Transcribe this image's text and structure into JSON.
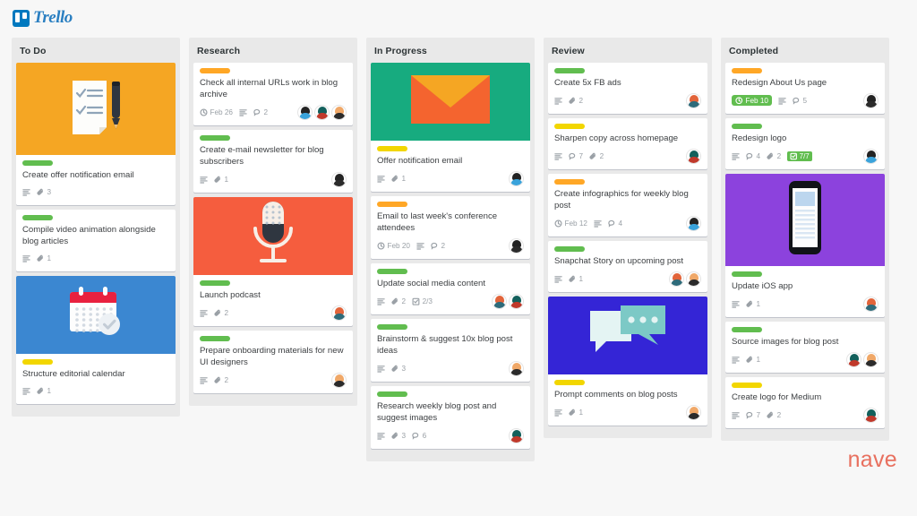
{
  "brand": {
    "name": "Trello",
    "mark": "trello-logo-icon"
  },
  "footer": {
    "vendor": "nave"
  },
  "colors": {
    "label_green": "#61bd4f",
    "label_yellow": "#f2d600",
    "label_orange": "#ffa726",
    "trello_blue": "#0079bf",
    "nave_red": "#e8705f",
    "column_bg": "#e9e9e9",
    "page_bg": "#f7f7f7"
  },
  "columns": [
    {
      "title": "To Do",
      "cards": [
        {
          "cover": "orange",
          "cover_icon": "checklist-and-pen-illustration",
          "label": "green",
          "title": "Create offer notification email",
          "meta": [
            {
              "icon": "description-icon"
            },
            {
              "icon": "attachment-icon",
              "value": "3"
            }
          ],
          "avatars": []
        },
        {
          "label": "green",
          "title": "Compile video animation alongside blog articles",
          "meta": [
            {
              "icon": "description-icon"
            },
            {
              "icon": "attachment-icon",
              "value": "1"
            }
          ],
          "avatars": []
        },
        {
          "cover": "blue",
          "cover_icon": "calendar-check-illustration",
          "label": "yellow",
          "title": "Structure editorial calendar",
          "meta": [
            {
              "icon": "description-icon"
            },
            {
              "icon": "attachment-icon",
              "value": "1"
            }
          ],
          "avatars": []
        }
      ]
    },
    {
      "title": "Research",
      "cards": [
        {
          "label": "orange",
          "title": "Check all internal URLs work in blog archive",
          "meta": [
            {
              "icon": "clock-icon",
              "value": "Feb 26"
            },
            {
              "icon": "description-icon"
            },
            {
              "icon": "comment-icon",
              "value": "2"
            }
          ],
          "avatars": [
            "dark-hair-blue-shirt",
            "teal-hair-red-shirt",
            "ginger-hair-dark-shirt"
          ]
        },
        {
          "label": "green",
          "title": "Create e-mail newsletter for blog subscribers",
          "meta": [
            {
              "icon": "description-icon"
            },
            {
              "icon": "attachment-icon",
              "value": "1"
            }
          ],
          "avatars": [
            "dark-hair-dark-shirt"
          ]
        },
        {
          "cover": "red",
          "cover_icon": "microphone-illustration",
          "label": "green",
          "title": "Launch podcast",
          "meta": [
            {
              "icon": "description-icon"
            },
            {
              "icon": "attachment-icon",
              "value": "2"
            }
          ],
          "avatars": [
            "red-hair-teal-shirt"
          ]
        },
        {
          "label": "green",
          "title": "Prepare onboarding materials for new UI designers",
          "meta": [
            {
              "icon": "description-icon"
            },
            {
              "icon": "attachment-icon",
              "value": "2"
            }
          ],
          "avatars": [
            "ginger-hair-dark-shirt"
          ]
        }
      ]
    },
    {
      "title": "In Progress",
      "cards": [
        {
          "cover": "green",
          "cover_icon": "envelope-illustration",
          "label": "yellow",
          "title": "Offer notification email",
          "meta": [
            {
              "icon": "description-icon"
            },
            {
              "icon": "attachment-icon",
              "value": "1"
            }
          ],
          "avatars": [
            "dark-hair-blue-shirt"
          ]
        },
        {
          "label": "orange",
          "title": "Email to last week's conference attendees",
          "meta": [
            {
              "icon": "clock-icon",
              "value": "Feb 20"
            },
            {
              "icon": "description-icon"
            },
            {
              "icon": "comment-icon",
              "value": "2"
            }
          ],
          "avatars": [
            "dark-hair-dark-shirt"
          ]
        },
        {
          "label": "green",
          "title": "Update social media content",
          "meta": [
            {
              "icon": "description-icon"
            },
            {
              "icon": "attachment-icon",
              "value": "2"
            },
            {
              "icon": "checklist-icon",
              "value": "2/3"
            }
          ],
          "avatars": [
            "red-hair-teal-shirt",
            "teal-hair-red-shirt"
          ]
        },
        {
          "label": "green",
          "title": "Brainstorm & suggest 10x blog post ideas",
          "meta": [
            {
              "icon": "description-icon"
            },
            {
              "icon": "attachment-icon",
              "value": "3"
            }
          ],
          "avatars": [
            "ginger-hair-dark-shirt"
          ]
        },
        {
          "label": "green",
          "title": "Research weekly blog post and suggest images",
          "meta": [
            {
              "icon": "description-icon"
            },
            {
              "icon": "attachment-icon",
              "value": "3"
            },
            {
              "icon": "comment-icon",
              "value": "6"
            }
          ],
          "avatars": [
            "teal-hair-red-shirt"
          ]
        }
      ]
    },
    {
      "title": "Review",
      "cards": [
        {
          "label": "green",
          "title": "Create 5x FB ads",
          "meta": [
            {
              "icon": "description-icon"
            },
            {
              "icon": "attachment-icon",
              "value": "2"
            }
          ],
          "avatars": [
            "red-hair-teal-shirt"
          ]
        },
        {
          "label": "yellow",
          "title": "Sharpen copy across homepage",
          "meta": [
            {
              "icon": "description-icon"
            },
            {
              "icon": "comment-icon",
              "value": "7"
            },
            {
              "icon": "attachment-icon",
              "value": "2"
            }
          ],
          "avatars": [
            "teal-hair-red-shirt"
          ]
        },
        {
          "label": "orange",
          "title": "Create infographics for weekly blog post",
          "meta": [
            {
              "icon": "clock-icon",
              "value": "Feb 12"
            },
            {
              "icon": "description-icon"
            },
            {
              "icon": "comment-icon",
              "value": "4"
            }
          ],
          "avatars": [
            "dark-hair-blue-shirt"
          ]
        },
        {
          "label": "green",
          "title": "Snapchat Story on upcoming post",
          "meta": [
            {
              "icon": "description-icon"
            },
            {
              "icon": "attachment-icon",
              "value": "1"
            }
          ],
          "avatars": [
            "red-hair-teal-shirt",
            "ginger-hair-dark-shirt"
          ]
        },
        {
          "cover": "indigo",
          "cover_icon": "speech-bubbles-illustration",
          "label": "yellow",
          "title": "Prompt comments on blog posts",
          "meta": [
            {
              "icon": "description-icon"
            },
            {
              "icon": "attachment-icon",
              "value": "1"
            }
          ],
          "avatars": [
            "ginger-hair-dark-shirt"
          ]
        }
      ]
    },
    {
      "title": "Completed",
      "cards": [
        {
          "label": "orange",
          "title": "Redesign About Us page",
          "meta": [
            {
              "icon": "clock-badge-icon",
              "value": "Feb 10",
              "style": "badge-date"
            },
            {
              "icon": "description-icon"
            },
            {
              "icon": "comment-icon",
              "value": "5"
            }
          ],
          "avatars": [
            "dark-hair-dark-shirt"
          ]
        },
        {
          "label": "green",
          "title": "Redesign logo",
          "meta": [
            {
              "icon": "description-icon"
            },
            {
              "icon": "comment-icon",
              "value": "4"
            },
            {
              "icon": "attachment-icon",
              "value": "2"
            },
            {
              "icon": "checklist-badge-icon",
              "value": "7/7",
              "style": "badge-check"
            }
          ],
          "avatars": [
            "dark-hair-blue-shirt"
          ]
        },
        {
          "cover": "purple",
          "cover_icon": "mobile-phone-illustration",
          "label": "green",
          "title": "Update iOS app",
          "meta": [
            {
              "icon": "description-icon"
            },
            {
              "icon": "attachment-icon",
              "value": "1"
            }
          ],
          "avatars": [
            "red-hair-teal-shirt"
          ]
        },
        {
          "label": "green",
          "title": "Source images for blog post",
          "meta": [
            {
              "icon": "description-icon"
            },
            {
              "icon": "attachment-icon",
              "value": "1"
            }
          ],
          "avatars": [
            "teal-hair-red-shirt",
            "ginger-hair-dark-shirt"
          ]
        },
        {
          "label": "yellow",
          "title": "Create logo for Medium",
          "meta": [
            {
              "icon": "description-icon"
            },
            {
              "icon": "comment-icon",
              "value": "7"
            },
            {
              "icon": "attachment-icon",
              "value": "2"
            }
          ],
          "avatars": [
            "teal-hair-red-shirt"
          ]
        }
      ]
    }
  ]
}
